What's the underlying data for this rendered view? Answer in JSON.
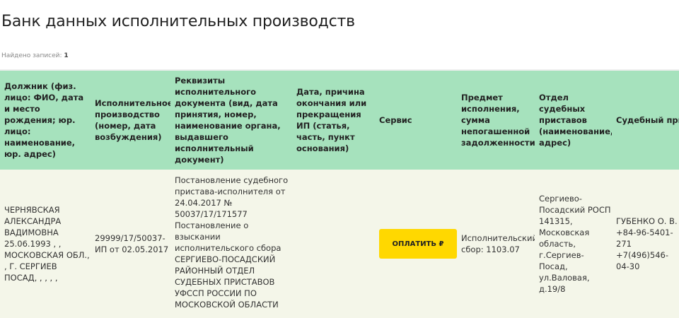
{
  "page": {
    "title": "Банк данных исполнительных производств",
    "records_label": "Найдено записей:",
    "records_count": "1"
  },
  "table": {
    "headers": [
      "Должник (физ. лицо: ФИО, дата и место рождения; юр. лицо: наименование, юр. адрес)",
      "Исполнительное производство (номер, дата возбуждения)",
      "Реквизиты исполнительного документа (вид, дата принятия, номер, наименование органа, выдавшего исполнительный документ)",
      "Дата, причина окончания или прекращения ИП (статья, часть, пункт основания)",
      "Сервис",
      "Предмет исполнения, сумма непогашенной задолженности",
      "Отдел судебных приставов (наименование, адрес)",
      "Судебный пристав-исполнитель"
    ],
    "row": {
      "debtor": "ЧЕРНЯВСКАЯ АЛЕКСАНДРА ВАДИМОВНА 25.06.1993 , , МОСКОВСКАЯ ОБЛ., , Г. СЕРГИЕВ ПОСАД, , , , ,",
      "proceeding": "29999/17/50037-ИП от 02.05.2017",
      "document_lines": [
        "Постановление судебного пристава-исполнителя от 24.04.2017 № 50037/17/171577",
        "Постановление о взыскании исполнительского сбора СЕРГИЕВО-ПОСАДСКИЙ РАЙОННЫЙ ОТДЕЛ СУДЕБНЫХ ПРИСТАВОВ УФССП РОССИИ ПО МОСКОВСКОЙ ОБЛАСТИ"
      ],
      "end_info": "",
      "pay_button": "ОПЛАТИТЬ ₽",
      "subject": "Исполнительский сбор: 1103.07",
      "department_lines": [
        "Сергиево-Посадский РОСП",
        "141315, Московская область, г.Сергиев-Посад, ул.Валовая, д.19/8"
      ],
      "bailiff_lines": [
        "ГУБЕНКО О. В.",
        "+84-96-5401-271",
        "+7(496)546-04-30"
      ]
    }
  }
}
